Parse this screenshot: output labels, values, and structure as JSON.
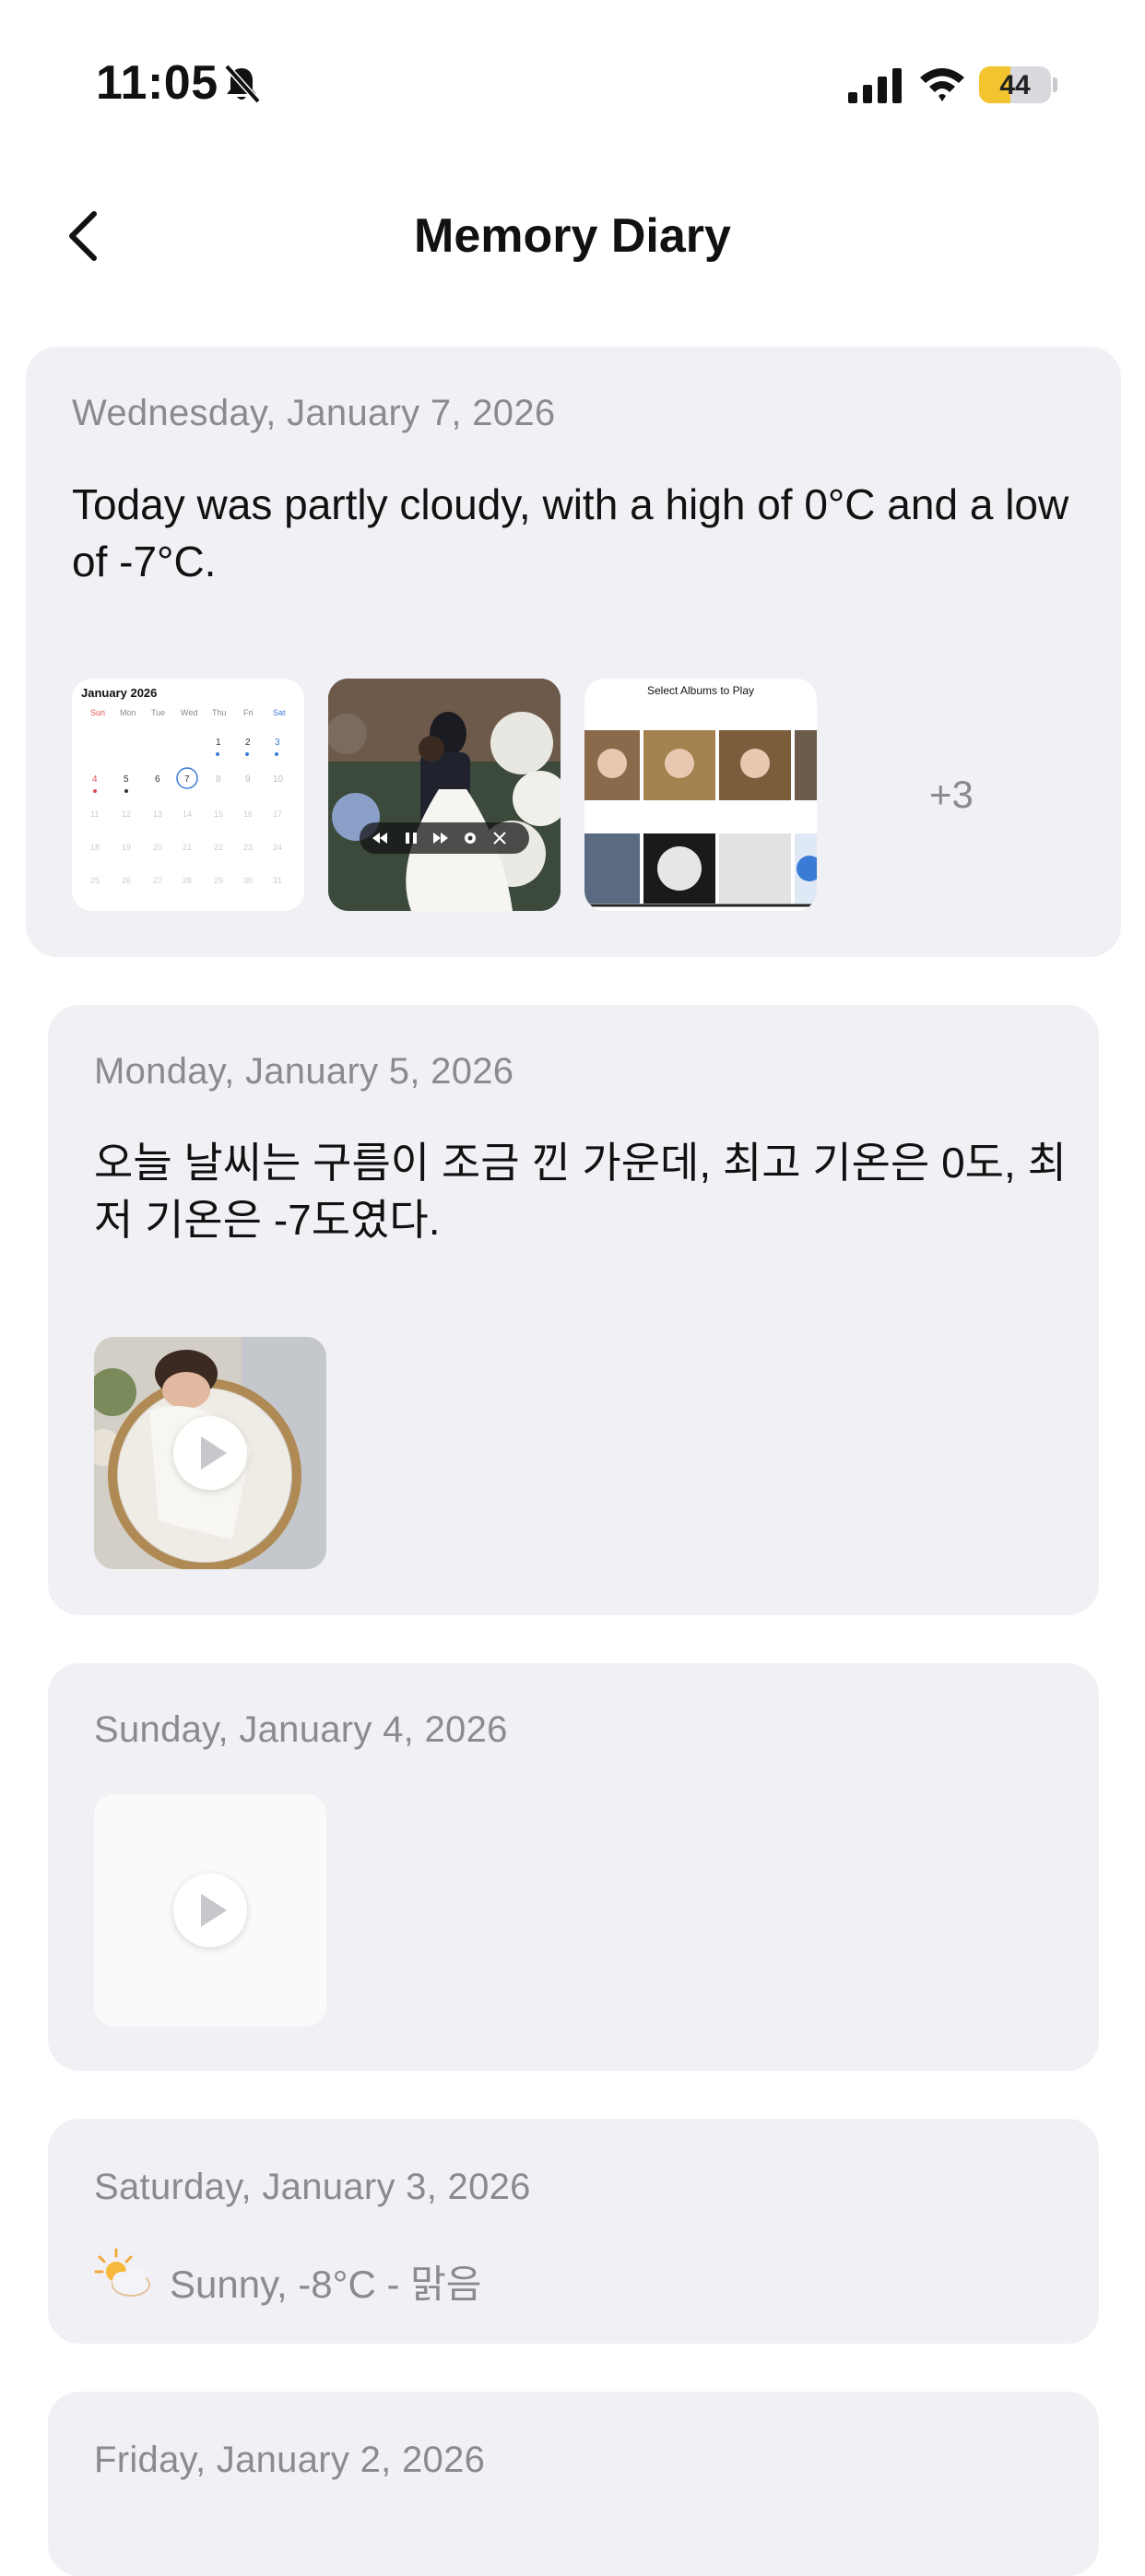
{
  "status_bar": {
    "time": "11:05",
    "battery_text": "44",
    "battery_level": 0.44,
    "battery_color": "#f4c430"
  },
  "header": {
    "title": "Memory Diary",
    "back_icon": "chevron-left-icon"
  },
  "entries": [
    {
      "date": "Wednesday, January 7, 2026",
      "text": "Today was partly cloudy, with a high of 0°C and a low of -7°C.",
      "thumbnails": [
        {
          "kind": "calendar-screenshot",
          "caption": "January 2026"
        },
        {
          "kind": "wedding-video-screenshot"
        },
        {
          "kind": "album-picker-screenshot",
          "caption": "Select Albums to Play"
        }
      ],
      "more_count": "+3"
    },
    {
      "date": "Monday, January 5, 2026",
      "text": "오늘 날씨는 구름이 조금 낀 가운데, 최고 기온은 0도, 최저 기온은 -7도였다.",
      "thumbnails": [
        {
          "kind": "baby-video",
          "icon": "play-icon"
        }
      ]
    },
    {
      "date": "Sunday, January 4, 2026",
      "thumbnails": [
        {
          "kind": "blank-video",
          "icon": "play-icon"
        }
      ]
    },
    {
      "date": "Saturday, January 3, 2026",
      "weather": "Sunny, -8°C - 맑음",
      "weather_icon": "partly-sunny-icon"
    },
    {
      "date": "Friday, January 2, 2026"
    }
  ]
}
